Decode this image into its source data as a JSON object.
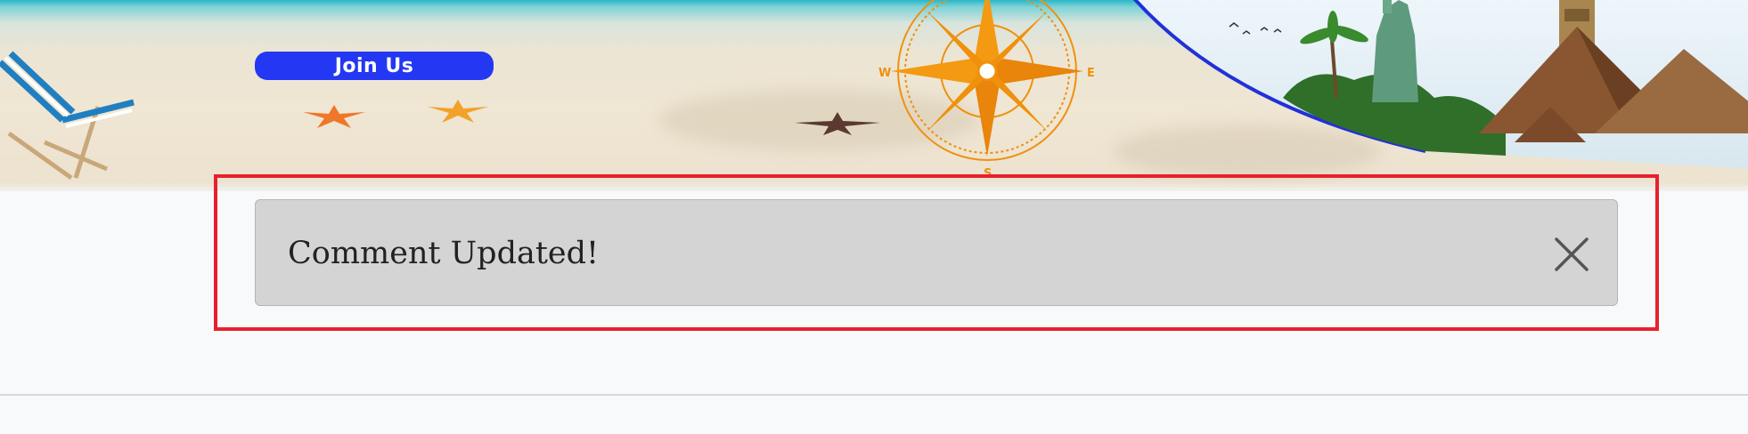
{
  "banner": {
    "join_label": "Join Us",
    "compass_labels": {
      "west": "W",
      "east": "E",
      "south": "S"
    }
  },
  "alert": {
    "message": "Comment Updated!",
    "close_icon": "close-icon"
  },
  "colors": {
    "join_button": "#2437f2",
    "alert_bg": "#d4d4d4",
    "highlight_border": "#e8202d",
    "compass": "#f0900c"
  }
}
